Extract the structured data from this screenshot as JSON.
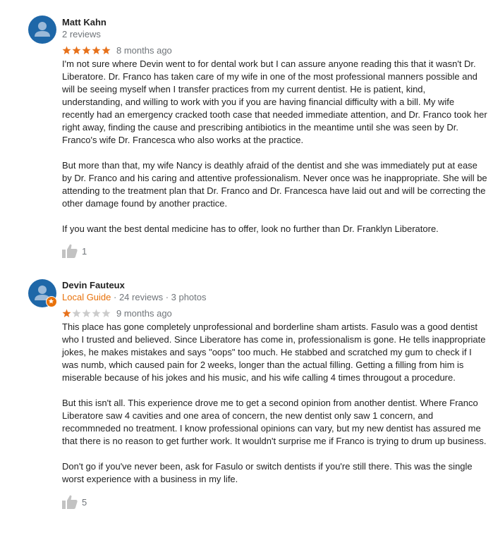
{
  "reviews": [
    {
      "name": "Matt Kahn",
      "meta": {
        "local_guide": "",
        "text": "2 reviews"
      },
      "rating": 5,
      "time": "8 months ago",
      "paragraphs": [
        "I'm not sure where Devin went to for dental work but I can assure anyone reading this that it wasn't Dr. Liberatore. Dr. Franco has taken care of my wife in one of the most professional manners possible and will be seeing myself when I transfer practices from my current dentist. He is patient, kind, understanding, and willing to work with you if you are having financial difficulty with a bill. My wife recently had an emergency cracked tooth case that needed immediate attention, and Dr. Franco took her right away, finding the cause and prescribing antibiotics in the meantime until she was seen by Dr. Franco's wife Dr. Francesca who also works at the practice.",
        "But more than that, my wife Nancy is deathly afraid of the dentist and she was immediately put at ease by Dr. Franco and his caring and attentive professionalism. Never once was he inappropriate. She will be attending to the treatment plan that Dr. Franco and Dr. Francesca have laid out and will be correcting the other damage found by another practice.",
        "If you want the best dental medicine has to offer, look no further than Dr. Franklyn Liberatore."
      ],
      "likes": "1"
    },
    {
      "name": "Devin Fauteux",
      "meta": {
        "local_guide": "Local Guide",
        "text": " · 24 reviews · 3 photos"
      },
      "rating": 1,
      "time": "9 months ago",
      "paragraphs": [
        "This place has gone completely unprofessional and borderline sham artists. Fasulo was a good dentist who I trusted and believed. Since Liberatore has come in, professionalism is gone. He tells inappropriate jokes, he makes mistakes and says \"oops\" too much. He stabbed and scratched my gum to check if I was numb, which caused pain for 2 weeks, longer than the actual filling. Getting a filling from him is miserable because of his jokes and his music, and his wife calling 4 times througout a procedure.",
        "But this isn't all. This experience drove me to get a second opinion from another dentist. Where Franco Liberatore saw 4 cavities and one area of concern, the new dentist only saw 1 concern, and recommneded no treatment. I know professional opinions can vary, but my new dentist has assured me that there is no reason to get further work. It wouldn't surprise me if Franco is trying to drum up business.",
        "Don't go if you've never been, ask for Fasulo or switch dentists if you're still there. This was the single worst experience with a business in my life."
      ],
      "likes": "5"
    }
  ],
  "colors": {
    "star_filled": "#e7711b",
    "star_empty": "#cccccc",
    "avatar": "#1e67a8",
    "guide": "#e8710a"
  },
  "icons": {
    "avatar": "person-icon",
    "like": "thumbs-up-icon",
    "guide_badge": "local-guide-badge-icon"
  }
}
